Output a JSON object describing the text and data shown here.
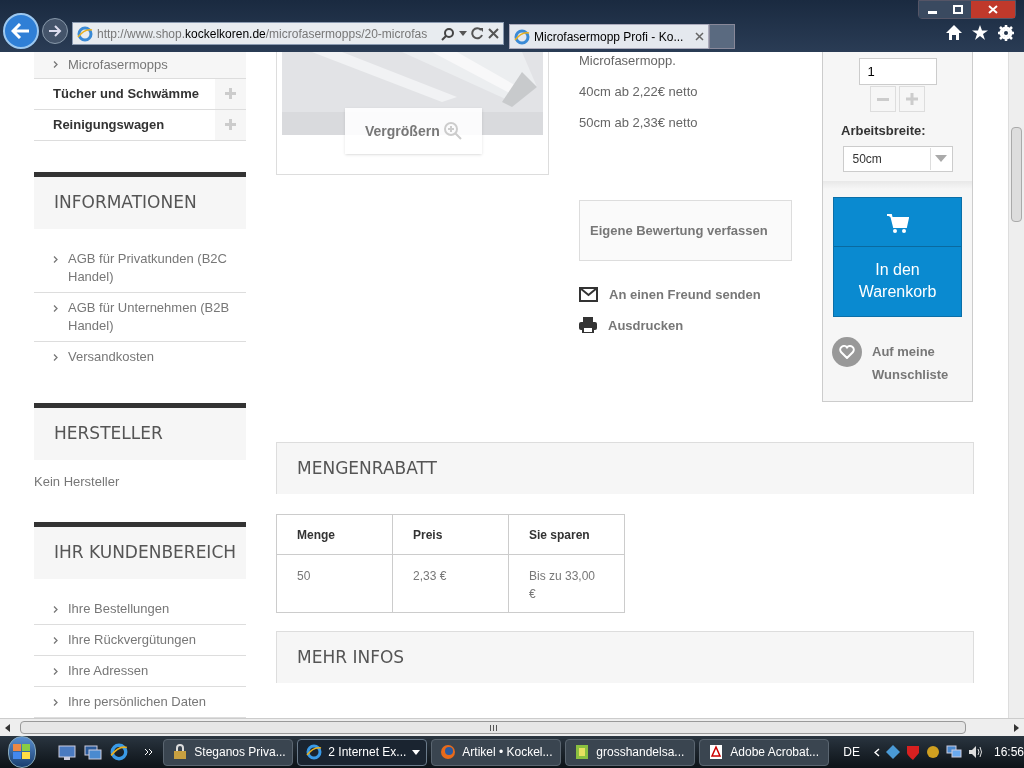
{
  "browser": {
    "address_parts": [
      {
        "text": "http://www.shop.",
        "kind": "dim"
      },
      {
        "text": "kockelkoren.de",
        "kind": "domain"
      },
      {
        "text": "/microfasermopps/20-microfas",
        "kind": "dim"
      }
    ],
    "tab": "Microfasermopp Profi - Ko..."
  },
  "sidebar": {
    "categories": [
      {
        "label": "Microfasermopps",
        "kind": "sub"
      },
      {
        "label": "Tücher und Schwämme",
        "kind": "main"
      },
      {
        "label": "Reinigungswagen",
        "kind": "main"
      }
    ],
    "blocks": [
      {
        "title": "INFORMATIONEN",
        "links": [
          "AGB für Privatkunden (B2C Handel)",
          "AGB für Unternehmen (B2B Handel)",
          "Versandkosten"
        ]
      },
      {
        "title": "HERSTELLER",
        "text": "Kein Hersteller"
      },
      {
        "title": "IHR KUNDENBEREICH",
        "links": [
          "Ihre Bestellungen",
          "Ihre Rückvergütungen",
          "Ihre Adressen",
          "Ihre persönlichen Daten"
        ]
      }
    ]
  },
  "product": {
    "zoom_label": "Vergrößern",
    "lines": [
      "Microfasermopp.",
      "40cm ab 2,22€ netto",
      "50cm ab 2,33€ netto"
    ],
    "review": "Eigene Bewertung verfassen",
    "actions": [
      {
        "kind": "mail",
        "label": "An einen Freund senden"
      },
      {
        "kind": "print",
        "label": "Ausdrucken"
      }
    ]
  },
  "buy": {
    "quantity": "1",
    "width_label": "Arbeitsbreite:",
    "width_value": "50cm",
    "cart": "In den Warenkorb",
    "wishlist": "Auf meine Wunschliste"
  },
  "discount": {
    "title": "MENGENRABATT",
    "columns": [
      "Menge",
      "Preis",
      "Sie sparen"
    ],
    "rows": [
      [
        "50",
        "2,33 €",
        "Bis zu 33,00 €"
      ]
    ]
  },
  "more": {
    "title": "MEHR INFOS"
  },
  "taskbar": {
    "items": [
      {
        "label": "Steganos Priva...",
        "kind": "lock",
        "selected": false
      },
      {
        "label": "2 Internet Ex...",
        "kind": "ie",
        "selected": true
      },
      {
        "label": "Artikel • Kockel...",
        "kind": "firefox",
        "selected": false
      },
      {
        "label": "grosshandelsa...",
        "kind": "file",
        "selected": false
      },
      {
        "label": "Adobe Acrobat...",
        "kind": "pdf",
        "selected": false
      }
    ],
    "language": "DE",
    "clock": "16:56"
  }
}
